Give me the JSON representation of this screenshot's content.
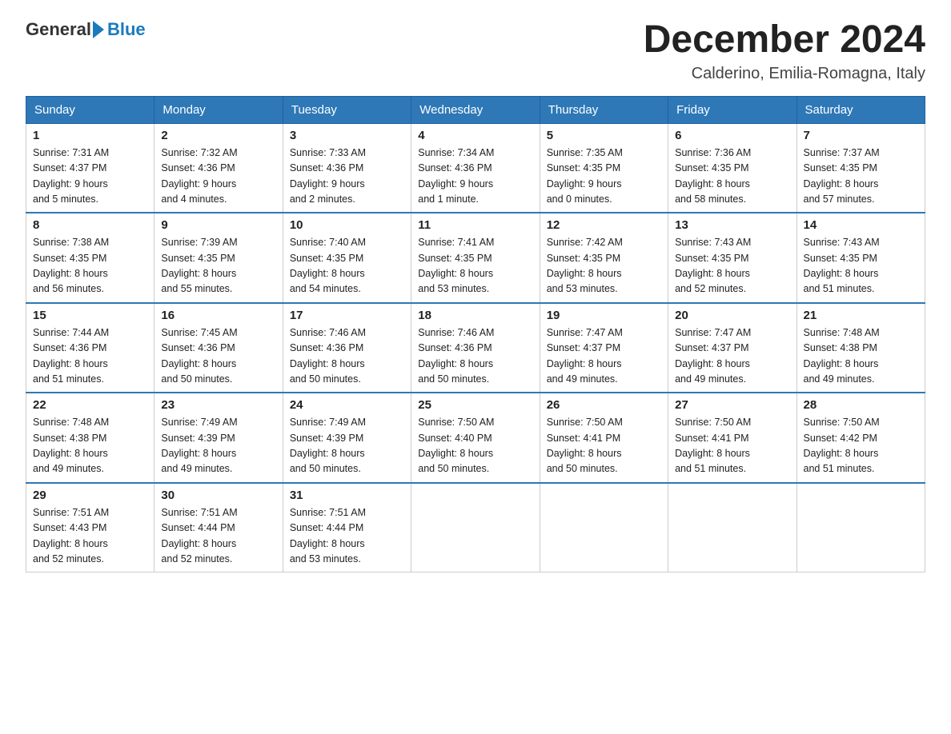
{
  "logo": {
    "general": "General",
    "blue": "Blue",
    "arrow_color": "#1a7abf"
  },
  "title": "December 2024",
  "location": "Calderino, Emilia-Romagna, Italy",
  "days_of_week": [
    "Sunday",
    "Monday",
    "Tuesday",
    "Wednesday",
    "Thursday",
    "Friday",
    "Saturday"
  ],
  "weeks": [
    [
      {
        "day": "1",
        "sunrise": "7:31 AM",
        "sunset": "4:37 PM",
        "daylight": "9 hours and 5 minutes."
      },
      {
        "day": "2",
        "sunrise": "7:32 AM",
        "sunset": "4:36 PM",
        "daylight": "9 hours and 4 minutes."
      },
      {
        "day": "3",
        "sunrise": "7:33 AM",
        "sunset": "4:36 PM",
        "daylight": "9 hours and 2 minutes."
      },
      {
        "day": "4",
        "sunrise": "7:34 AM",
        "sunset": "4:36 PM",
        "daylight": "9 hours and 1 minute."
      },
      {
        "day": "5",
        "sunrise": "7:35 AM",
        "sunset": "4:35 PM",
        "daylight": "9 hours and 0 minutes."
      },
      {
        "day": "6",
        "sunrise": "7:36 AM",
        "sunset": "4:35 PM",
        "daylight": "8 hours and 58 minutes."
      },
      {
        "day": "7",
        "sunrise": "7:37 AM",
        "sunset": "4:35 PM",
        "daylight": "8 hours and 57 minutes."
      }
    ],
    [
      {
        "day": "8",
        "sunrise": "7:38 AM",
        "sunset": "4:35 PM",
        "daylight": "8 hours and 56 minutes."
      },
      {
        "day": "9",
        "sunrise": "7:39 AM",
        "sunset": "4:35 PM",
        "daylight": "8 hours and 55 minutes."
      },
      {
        "day": "10",
        "sunrise": "7:40 AM",
        "sunset": "4:35 PM",
        "daylight": "8 hours and 54 minutes."
      },
      {
        "day": "11",
        "sunrise": "7:41 AM",
        "sunset": "4:35 PM",
        "daylight": "8 hours and 53 minutes."
      },
      {
        "day": "12",
        "sunrise": "7:42 AM",
        "sunset": "4:35 PM",
        "daylight": "8 hours and 53 minutes."
      },
      {
        "day": "13",
        "sunrise": "7:43 AM",
        "sunset": "4:35 PM",
        "daylight": "8 hours and 52 minutes."
      },
      {
        "day": "14",
        "sunrise": "7:43 AM",
        "sunset": "4:35 PM",
        "daylight": "8 hours and 51 minutes."
      }
    ],
    [
      {
        "day": "15",
        "sunrise": "7:44 AM",
        "sunset": "4:36 PM",
        "daylight": "8 hours and 51 minutes."
      },
      {
        "day": "16",
        "sunrise": "7:45 AM",
        "sunset": "4:36 PM",
        "daylight": "8 hours and 50 minutes."
      },
      {
        "day": "17",
        "sunrise": "7:46 AM",
        "sunset": "4:36 PM",
        "daylight": "8 hours and 50 minutes."
      },
      {
        "day": "18",
        "sunrise": "7:46 AM",
        "sunset": "4:36 PM",
        "daylight": "8 hours and 50 minutes."
      },
      {
        "day": "19",
        "sunrise": "7:47 AM",
        "sunset": "4:37 PM",
        "daylight": "8 hours and 49 minutes."
      },
      {
        "day": "20",
        "sunrise": "7:47 AM",
        "sunset": "4:37 PM",
        "daylight": "8 hours and 49 minutes."
      },
      {
        "day": "21",
        "sunrise": "7:48 AM",
        "sunset": "4:38 PM",
        "daylight": "8 hours and 49 minutes."
      }
    ],
    [
      {
        "day": "22",
        "sunrise": "7:48 AM",
        "sunset": "4:38 PM",
        "daylight": "8 hours and 49 minutes."
      },
      {
        "day": "23",
        "sunrise": "7:49 AM",
        "sunset": "4:39 PM",
        "daylight": "8 hours and 49 minutes."
      },
      {
        "day": "24",
        "sunrise": "7:49 AM",
        "sunset": "4:39 PM",
        "daylight": "8 hours and 50 minutes."
      },
      {
        "day": "25",
        "sunrise": "7:50 AM",
        "sunset": "4:40 PM",
        "daylight": "8 hours and 50 minutes."
      },
      {
        "day": "26",
        "sunrise": "7:50 AM",
        "sunset": "4:41 PM",
        "daylight": "8 hours and 50 minutes."
      },
      {
        "day": "27",
        "sunrise": "7:50 AM",
        "sunset": "4:41 PM",
        "daylight": "8 hours and 51 minutes."
      },
      {
        "day": "28",
        "sunrise": "7:50 AM",
        "sunset": "4:42 PM",
        "daylight": "8 hours and 51 minutes."
      }
    ],
    [
      {
        "day": "29",
        "sunrise": "7:51 AM",
        "sunset": "4:43 PM",
        "daylight": "8 hours and 52 minutes."
      },
      {
        "day": "30",
        "sunrise": "7:51 AM",
        "sunset": "4:44 PM",
        "daylight": "8 hours and 52 minutes."
      },
      {
        "day": "31",
        "sunrise": "7:51 AM",
        "sunset": "4:44 PM",
        "daylight": "8 hours and 53 minutes."
      },
      null,
      null,
      null,
      null
    ]
  ],
  "labels": {
    "sunrise": "Sunrise:",
    "sunset": "Sunset:",
    "daylight": "Daylight:"
  }
}
